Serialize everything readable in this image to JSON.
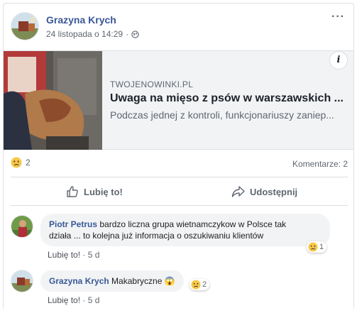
{
  "post": {
    "author": "Grazyna Krych",
    "timestamp": "24 listopada o 14:29",
    "separator": "·",
    "more_icon": "···"
  },
  "link_preview": {
    "domain": "TWOJENOWINKI.PL",
    "title": "Uwaga na mięso z psów w warszawskich ...",
    "description": "Podczas jednej z kontroli, funkcjonariuszy zaniep...",
    "info_icon": "i"
  },
  "stats": {
    "reaction_count": "2",
    "comments_label": "Komentarze: 2"
  },
  "actions": {
    "like_label": "Lubię to!",
    "share_label": "Udostępnij"
  },
  "comments": [
    {
      "author": "Piotr Petrus",
      "text_line1": "bardzo liczna grupa wietnamczykow w Polsce tak",
      "text_line2": "działa ... to kolejna już informacja o oszukiwaniu klientów",
      "like_label": "Lubię to!",
      "age": "5 d",
      "reaction_count": "1"
    },
    {
      "author": "Grazyna Krych",
      "text": "Makabryczne",
      "emoji": "😱",
      "like_label": "Lubię to!",
      "age": "5 d",
      "reaction_count": "2"
    }
  ],
  "colors": {
    "name_blue": "#385898",
    "meta_gray": "#606770",
    "bubble_bg": "#f2f3f5",
    "border": "#dddfe2"
  }
}
